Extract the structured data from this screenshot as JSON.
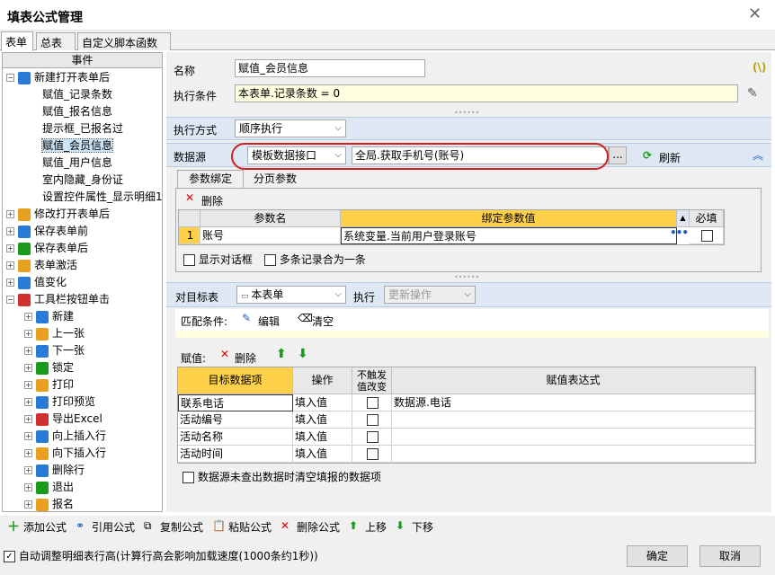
{
  "window": {
    "title": "填表公式管理"
  },
  "tabs": [
    "表单",
    "总表",
    "自定义脚本函数"
  ],
  "tree": {
    "header": "事件",
    "items": [
      {
        "label": "新建打开表单后",
        "level": 0
      },
      {
        "label": "赋值_记录条数",
        "level": 1
      },
      {
        "label": "赋值_报名信息",
        "level": 1
      },
      {
        "label": "提示框_已报名过",
        "level": 1
      },
      {
        "label": "赋值_会员信息",
        "level": 1
      },
      {
        "label": "赋值_用户信息",
        "level": 1
      },
      {
        "label": "室内隐藏_身份证",
        "level": 1
      },
      {
        "label": "设置控件属性_显示明细1",
        "level": 1
      },
      {
        "label": "修改打开表单后",
        "level": 0
      },
      {
        "label": "保存表单前",
        "level": 0
      },
      {
        "label": "保存表单后",
        "level": 0
      },
      {
        "label": "表单激活",
        "level": 0
      },
      {
        "label": "值变化",
        "level": 0
      },
      {
        "label": "工具栏按钮单击",
        "level": 0
      },
      {
        "label": "新建",
        "level": 1
      },
      {
        "label": "上一张",
        "level": 1
      },
      {
        "label": "下一张",
        "level": 1
      },
      {
        "label": "锁定",
        "level": 1
      },
      {
        "label": "打印",
        "level": 1
      },
      {
        "label": "打印预览",
        "level": 1
      },
      {
        "label": "导出Excel",
        "level": 1
      },
      {
        "label": "向上插入行",
        "level": 1
      },
      {
        "label": "向下插入行",
        "level": 1
      },
      {
        "label": "删除行",
        "level": 1
      },
      {
        "label": "退出",
        "level": 1
      },
      {
        "label": "报名",
        "level": 1
      }
    ]
  },
  "form": {
    "name_label": "名称",
    "name_value": "赋值_会员信息",
    "condition_label": "执行条件",
    "condition_value": "本表单.记录条数 = 0",
    "exec_mode_label": "执行方式",
    "exec_mode_value": "顺序执行",
    "datasource_label": "数据源",
    "datasource_type": "模板数据接口",
    "datasource_value": "全局.获取手机号(账号)",
    "browse": "...",
    "refresh": "刷新",
    "param_tabs": [
      "参数绑定",
      "分页参数"
    ],
    "delete": "删除",
    "param_headers": [
      "参数名",
      "绑定参数值",
      "必填"
    ],
    "param_rows": [
      {
        "num": "1",
        "name": "账号",
        "value": "系统变量.当前用户登录账号"
      }
    ],
    "show_dialog": "显示对话框",
    "merge_records": "多条记录合为一条",
    "target_label": "对目标表",
    "target_value": "本表单",
    "exec_label": "执行",
    "exec_value": "更新操作",
    "match_label": "匹配条件:",
    "edit": "编辑",
    "clear": "清空",
    "assign_label": "赋值:",
    "assign_headers": [
      "目标数据项",
      "操作",
      "不触发值改变",
      "赋值表达式"
    ],
    "assign_rows": [
      {
        "field": "联系电话",
        "op": "填入值",
        "expr": "数据源.电话"
      },
      {
        "field": "活动编号",
        "op": "填入值",
        "expr": ""
      },
      {
        "field": "活动名称",
        "op": "填入值",
        "expr": ""
      },
      {
        "field": "活动时间",
        "op": "填入值",
        "expr": ""
      }
    ],
    "clear_on_empty": "数据源未查出数据时清空填报的数据项"
  },
  "toolbar": {
    "add": "添加公式",
    "ref": "引用公式",
    "copy": "复制公式",
    "paste": "粘贴公式",
    "delete": "删除公式",
    "up": "上移",
    "down": "下移"
  },
  "footer": {
    "auto_row": "自动调整明细表行高(计算行高会影响加载速度(1000条约1秒))",
    "ok": "确定",
    "cancel": "取消"
  }
}
